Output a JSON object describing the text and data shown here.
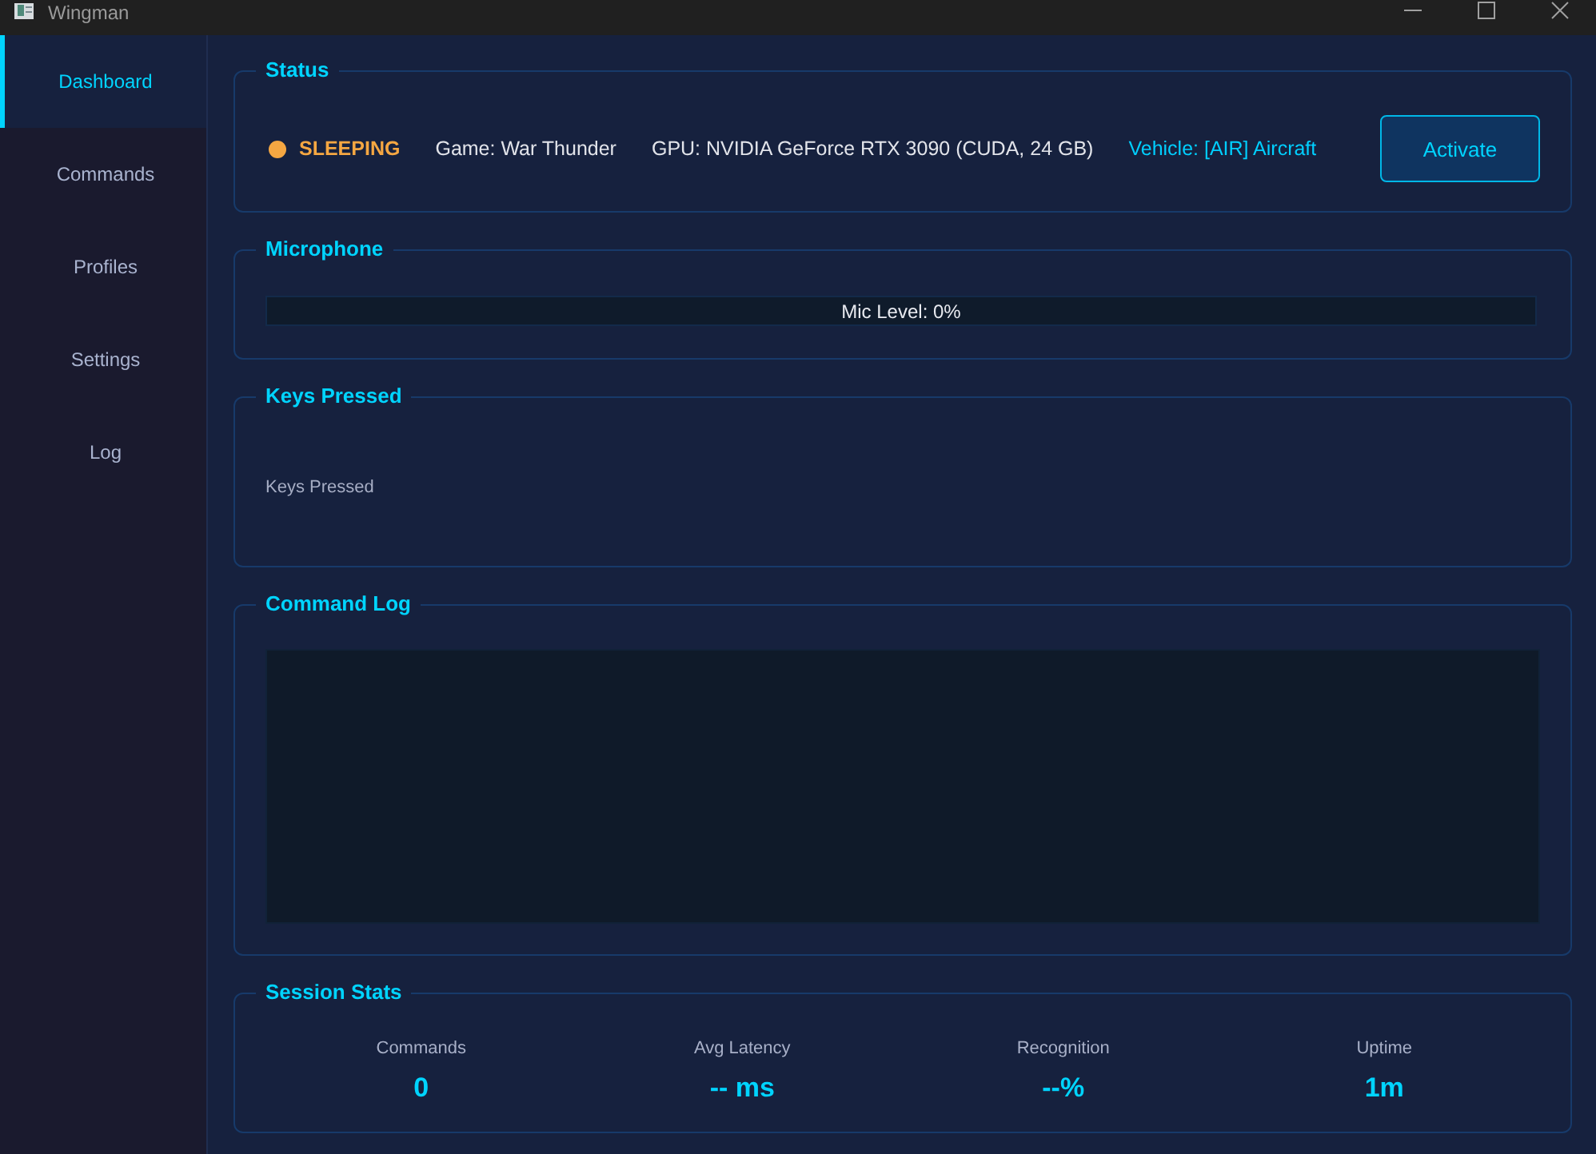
{
  "window": {
    "title": "Wingman"
  },
  "sidebar": {
    "items": [
      {
        "label": "Dashboard",
        "selected": true
      },
      {
        "label": "Commands",
        "selected": false
      },
      {
        "label": "Profiles",
        "selected": false
      },
      {
        "label": "Settings",
        "selected": false
      },
      {
        "label": "Log",
        "selected": false
      }
    ]
  },
  "status": {
    "title": "Status",
    "active": false,
    "state": "SLEEPING",
    "game": "Game: War Thunder",
    "gpu": "GPU: NVIDIA GeForce RTX 3090 (CUDA, 24 GB)",
    "vehicle": "Vehicle: [AIR] Aircraft",
    "button": "Activate"
  },
  "microphone": {
    "title": "Microphone",
    "level": 0,
    "reading": "Mic Level: 0%"
  },
  "keys_pressed": {
    "title": "Keys Pressed",
    "text": "Keys Pressed"
  },
  "command_log": {
    "title": "Command Log"
  },
  "session_stats": {
    "title": "Session Stats",
    "stats": [
      {
        "label": "Commands",
        "value": "0"
      },
      {
        "label": "Avg Latency",
        "value": "-- ms"
      },
      {
        "label": "Recognition",
        "value": "--%"
      },
      {
        "label": "Uptime",
        "value": "1m"
      }
    ]
  }
}
